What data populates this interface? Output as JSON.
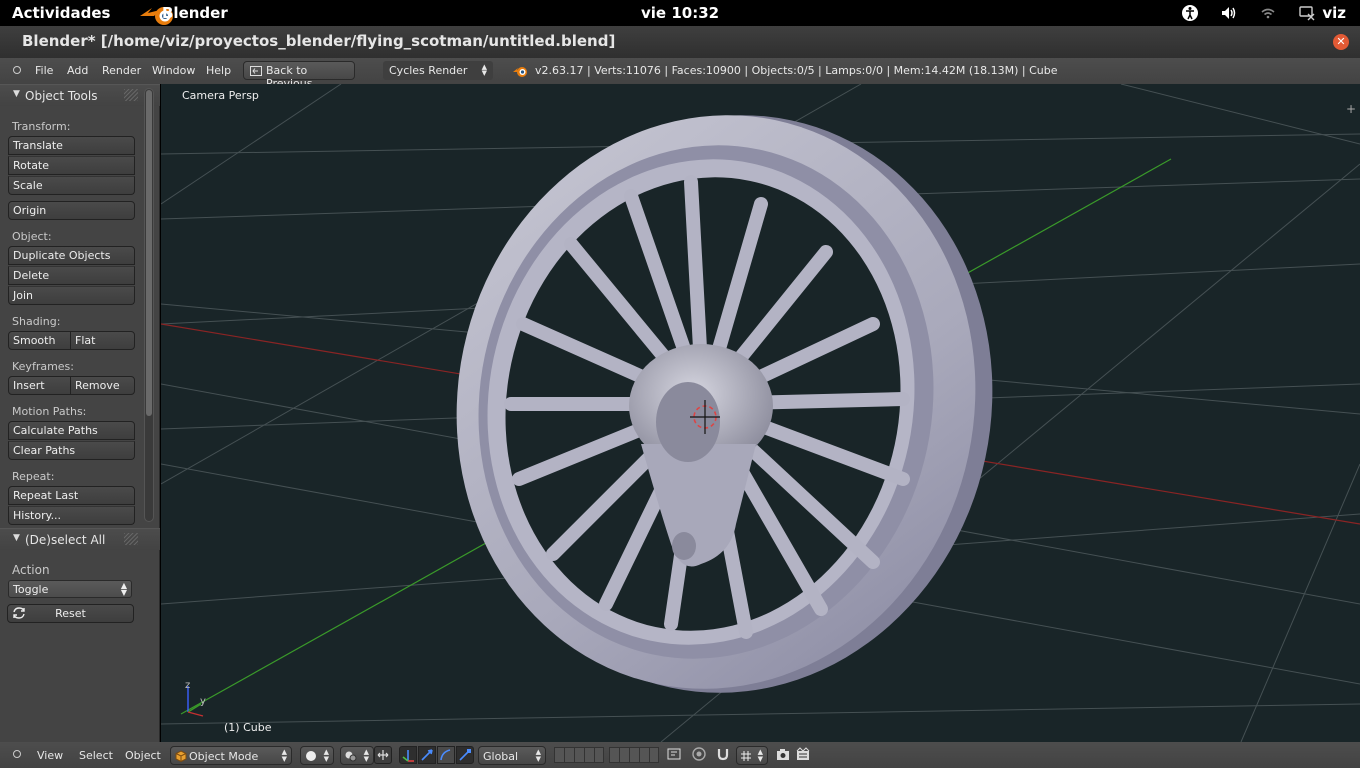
{
  "topbar": {
    "activities": "Actividades",
    "app_name": "Blender",
    "clock": "vie 10:32",
    "user": "viz"
  },
  "window": {
    "title": "Blender* [/home/viz/proyectos_blender/flying_scotman/untitled.blend]"
  },
  "info_header": {
    "menu": [
      "File",
      "Add",
      "Render",
      "Window",
      "Help"
    ],
    "back_button": "Back to Previous",
    "render_engine": "Cycles Render",
    "stats": "v2.63.17 | Verts:11076 | Faces:10900 | Objects:0/5 | Lamps:0/0 | Mem:14.42M (18.13M) | Cube"
  },
  "tool_shelf": {
    "panel_title": "Object Tools",
    "transform_label": "Transform:",
    "translate": "Translate",
    "rotate": "Rotate",
    "scale": "Scale",
    "origin": "Origin",
    "object_label": "Object:",
    "duplicate": "Duplicate Objects",
    "delete": "Delete",
    "join": "Join",
    "shading_label": "Shading:",
    "smooth": "Smooth",
    "flat": "Flat",
    "keyframes_label": "Keyframes:",
    "insert": "Insert",
    "remove": "Remove",
    "motion_label": "Motion Paths:",
    "calculate_paths": "Calculate Paths",
    "clear_paths": "Clear Paths",
    "repeat_label": "Repeat:",
    "repeat_last": "Repeat Last",
    "history": "History..."
  },
  "operator_panel": {
    "title": "(De)select All",
    "action_label": "Action",
    "action_value": "Toggle",
    "reset": "Reset"
  },
  "viewport": {
    "view_label": "Camera Persp",
    "object_label": "(1) Cube",
    "axis_y": "y",
    "axis_z": "z"
  },
  "view3d_header": {
    "menu": [
      "View",
      "Select",
      "Object"
    ],
    "mode": "Object Mode",
    "orientation": "Global"
  },
  "colors": {
    "viewport_bg": "#192528",
    "panel_bg": "#444444",
    "header_bg": "#4a4a4a",
    "wheel": "#b9b9c9",
    "x_axis": "#8a2424",
    "y_axis": "#3a9a2a"
  }
}
